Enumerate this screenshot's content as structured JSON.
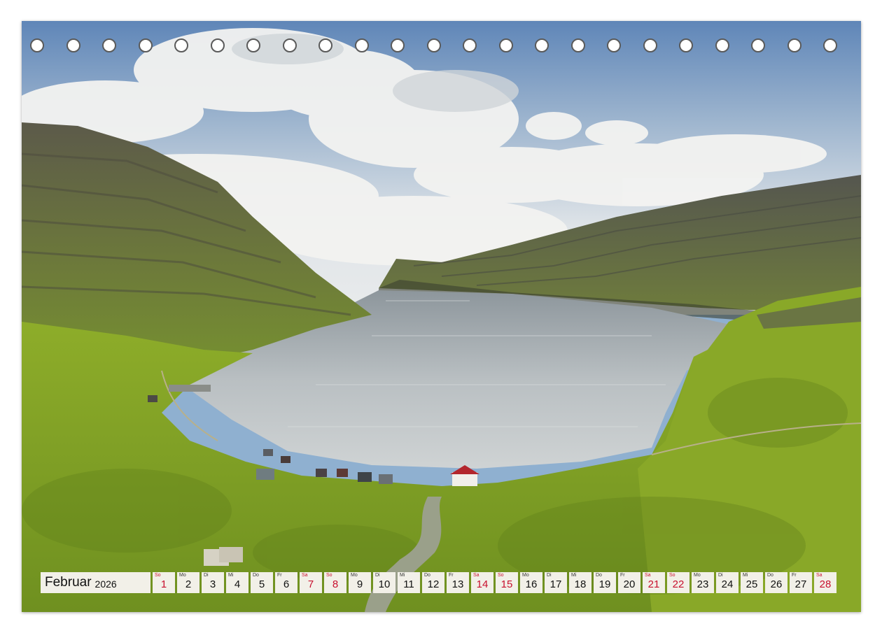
{
  "calendar": {
    "month": "Februar",
    "year": "2026",
    "days": [
      {
        "wd": "So",
        "d": "1",
        "holiday": true
      },
      {
        "wd": "Mo",
        "d": "2",
        "holiday": false
      },
      {
        "wd": "Di",
        "d": "3",
        "holiday": false
      },
      {
        "wd": "Mi",
        "d": "4",
        "holiday": false
      },
      {
        "wd": "Do",
        "d": "5",
        "holiday": false
      },
      {
        "wd": "Fr",
        "d": "6",
        "holiday": false
      },
      {
        "wd": "Sa",
        "d": "7",
        "holiday": true
      },
      {
        "wd": "So",
        "d": "8",
        "holiday": true
      },
      {
        "wd": "Mo",
        "d": "9",
        "holiday": false
      },
      {
        "wd": "Di",
        "d": "10",
        "holiday": false
      },
      {
        "wd": "Mi",
        "d": "11",
        "holiday": false
      },
      {
        "wd": "Do",
        "d": "12",
        "holiday": false
      },
      {
        "wd": "Fr",
        "d": "13",
        "holiday": false
      },
      {
        "wd": "Sa",
        "d": "14",
        "holiday": true
      },
      {
        "wd": "So",
        "d": "15",
        "holiday": true
      },
      {
        "wd": "Mo",
        "d": "16",
        "holiday": false
      },
      {
        "wd": "Di",
        "d": "17",
        "holiday": false
      },
      {
        "wd": "Mi",
        "d": "18",
        "holiday": false
      },
      {
        "wd": "Do",
        "d": "19",
        "holiday": false
      },
      {
        "wd": "Fr",
        "d": "20",
        "holiday": false
      },
      {
        "wd": "Sa",
        "d": "21",
        "holiday": true
      },
      {
        "wd": "So",
        "d": "22",
        "holiday": true
      },
      {
        "wd": "Mo",
        "d": "23",
        "holiday": false
      },
      {
        "wd": "Di",
        "d": "24",
        "holiday": false
      },
      {
        "wd": "Mi",
        "d": "25",
        "holiday": false
      },
      {
        "wd": "Do",
        "d": "26",
        "holiday": false
      },
      {
        "wd": "Fr",
        "d": "27",
        "holiday": false
      },
      {
        "wd": "Sa",
        "d": "28",
        "holiday": true
      }
    ]
  },
  "colors": {
    "weekend": "#c8102e",
    "strip_bg": "#f2f0e8"
  },
  "icons": [
    "binding-hole-icon"
  ]
}
